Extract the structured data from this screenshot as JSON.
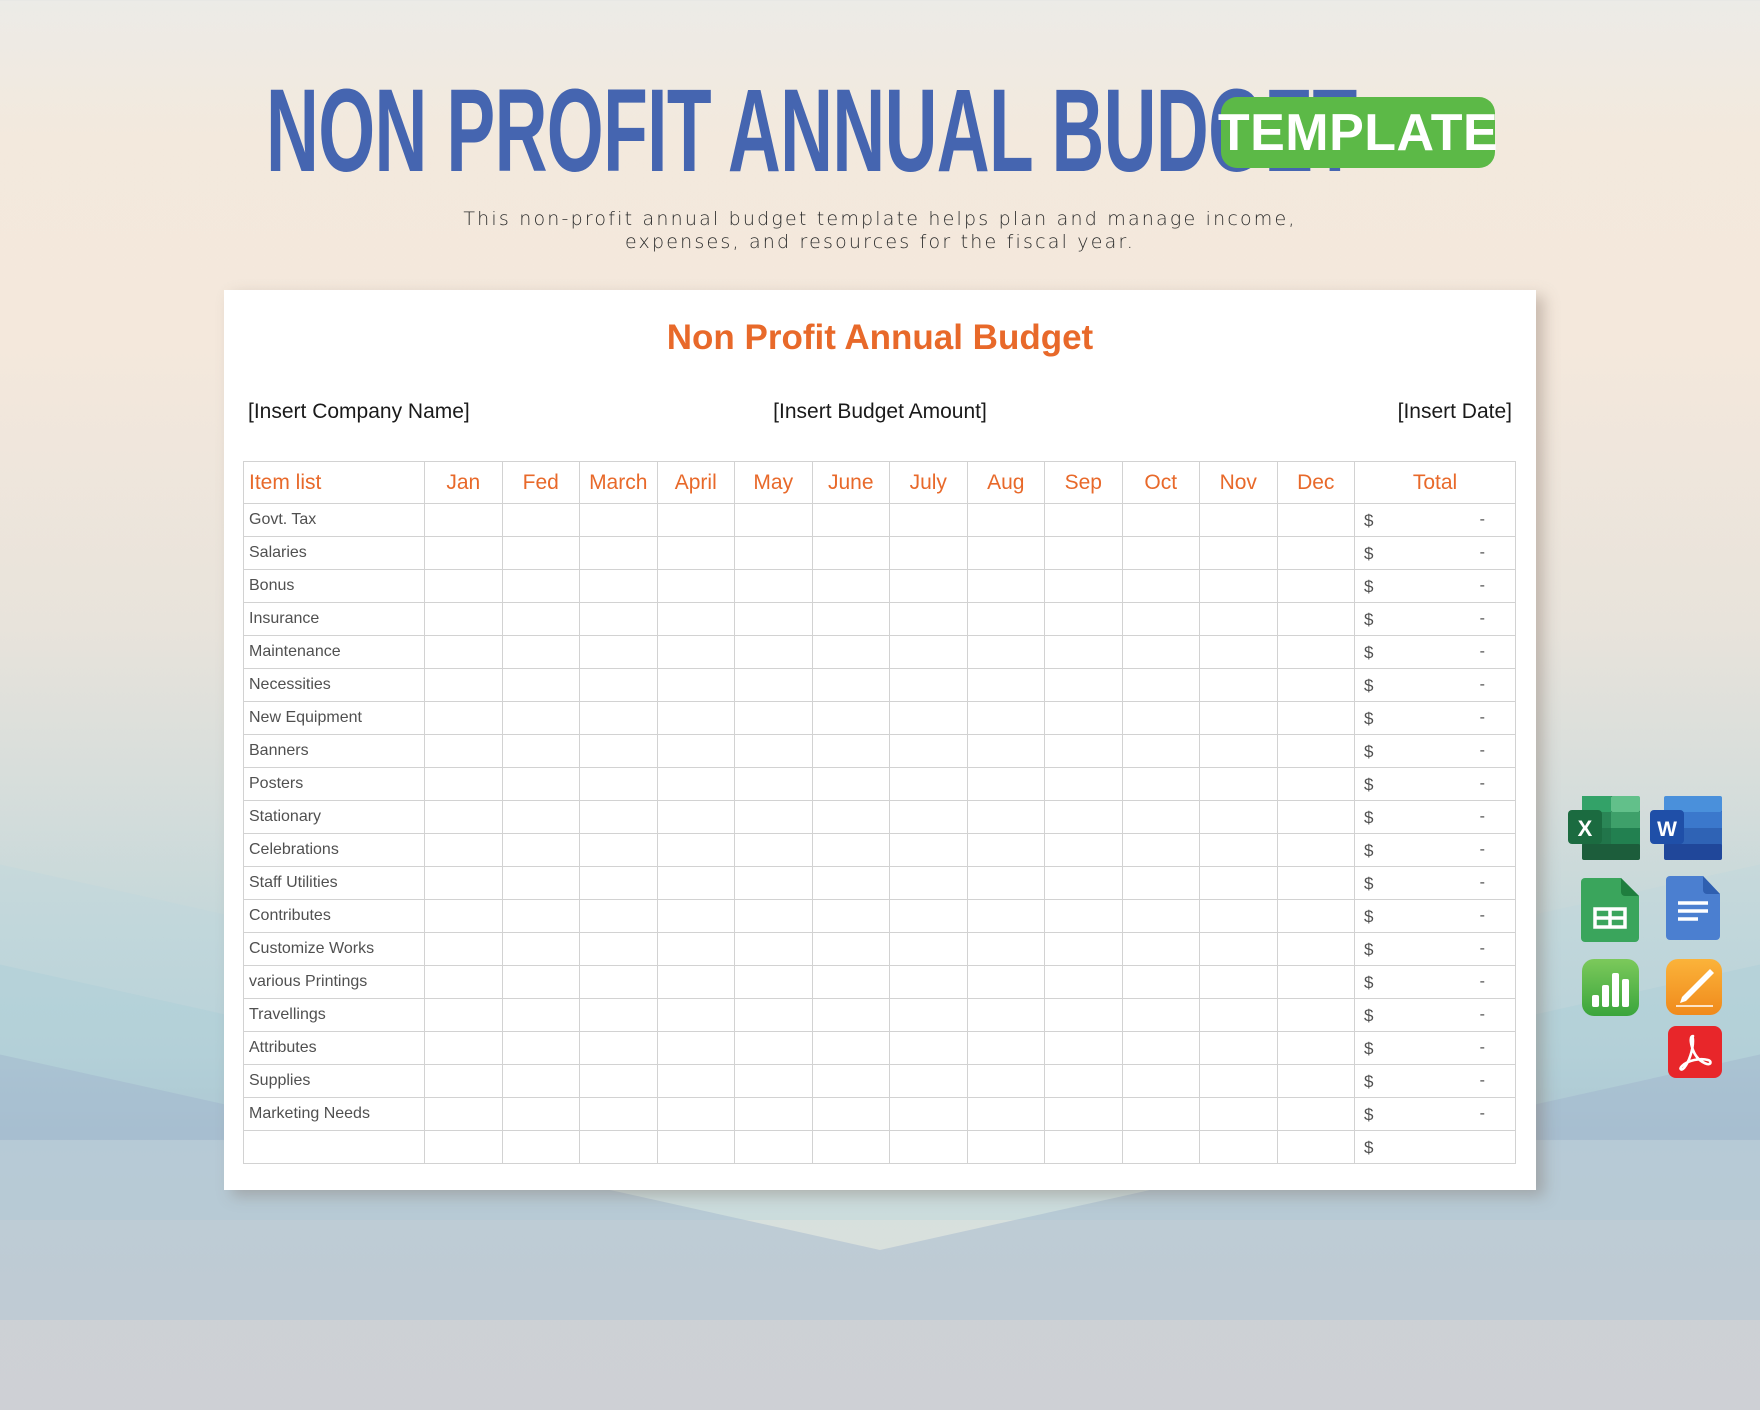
{
  "header": {
    "title": "NON PROFIT ANNUAL BUDGET",
    "badge": "TEMPLATE",
    "subtitle_lines": [
      "This non-profit annual budget template helps plan and manage income,",
      "expenses, and resources for the fiscal year."
    ]
  },
  "document": {
    "title": "Non Profit Annual Budget",
    "company_placeholder": "[Insert Company Name]",
    "amount_placeholder": "[Insert Budget Amount]",
    "date_placeholder": "[Insert Date]",
    "table": {
      "columns": [
        "Item list",
        "Jan",
        "Fed",
        "March",
        "April",
        "May",
        "June",
        "July",
        "Aug",
        "Sep",
        "Oct",
        "Nov",
        "Dec",
        "Total"
      ],
      "currency_symbol": "$",
      "empty_total": "-",
      "rows": [
        "Govt. Tax",
        "Salaries",
        "Bonus",
        "Insurance",
        "Maintenance",
        "Necessities",
        "New Equipment",
        "Banners",
        "Posters",
        "Stationary",
        "Celebrations",
        "Staff Utilities",
        "Contributes",
        "Customize Works",
        "various Printings",
        "Travellings",
        "Attributes",
        "Supplies",
        "Marketing Needs",
        ""
      ]
    }
  },
  "format_icons": [
    {
      "name": "excel-icon",
      "label": "X"
    },
    {
      "name": "word-icon",
      "label": "W"
    },
    {
      "name": "google-sheets-icon"
    },
    {
      "name": "google-docs-icon"
    },
    {
      "name": "apple-numbers-icon"
    },
    {
      "name": "apple-pages-icon"
    },
    {
      "name": "pdf-icon"
    }
  ],
  "colors": {
    "title_blue": "#4565b0",
    "badge_green": "#5cb947",
    "accent_orange": "#e8692a"
  }
}
